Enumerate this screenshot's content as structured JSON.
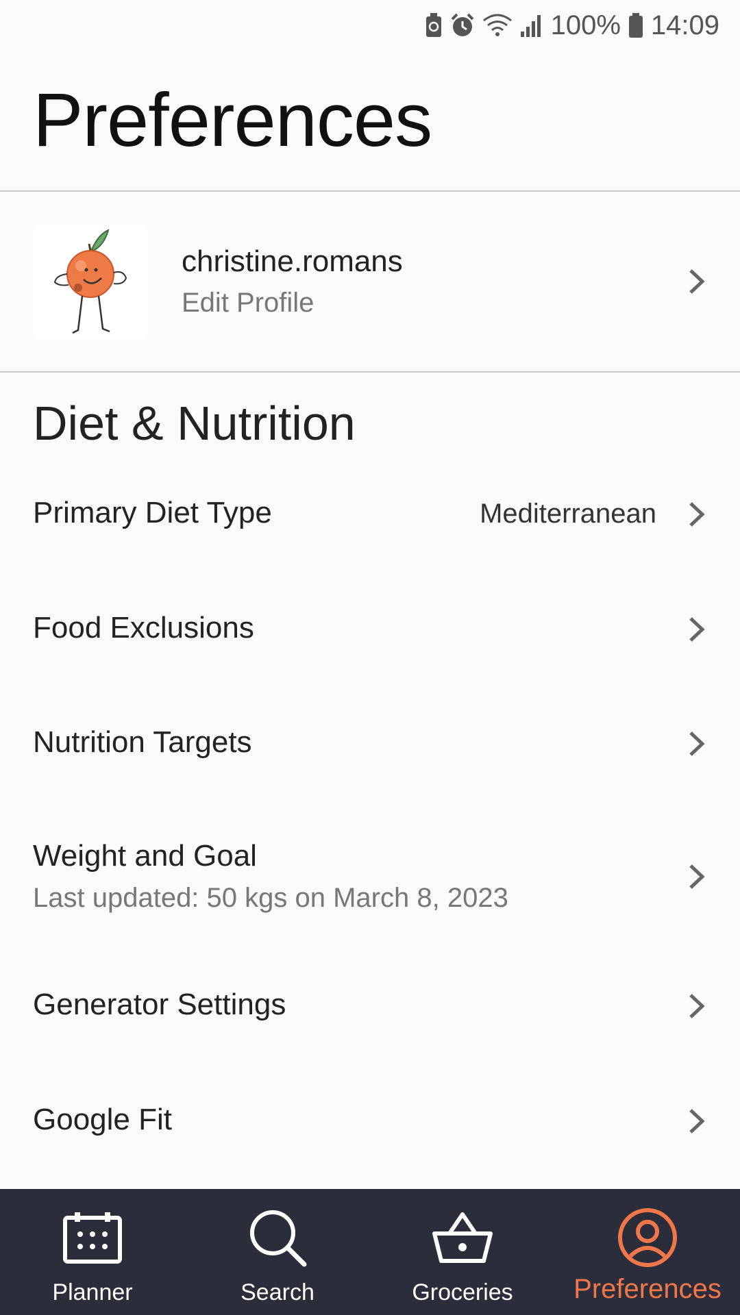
{
  "status_bar": {
    "battery_percent": "100%",
    "time": "14:09",
    "icons": [
      "battery-saver-icon",
      "alarm-icon",
      "wifi-icon",
      "signal-icon",
      "battery-icon"
    ]
  },
  "page": {
    "title": "Preferences"
  },
  "profile": {
    "username": "christine.romans",
    "subtitle": "Edit Profile",
    "avatar": "orange-character-avatar"
  },
  "section": {
    "title": "Diet & Nutrition"
  },
  "rows": [
    {
      "label": "Primary Diet Type",
      "value": "Mediterranean"
    },
    {
      "label": "Food Exclusions"
    },
    {
      "label": "Nutrition Targets"
    },
    {
      "label": "Weight and Goal",
      "sub": "Last updated:  50 kgs on March 8, 2023"
    },
    {
      "label": "Generator Settings"
    },
    {
      "label": "Google Fit"
    }
  ],
  "nav": {
    "items": [
      {
        "label": "Planner",
        "icon": "calendar-icon"
      },
      {
        "label": "Search",
        "icon": "search-icon"
      },
      {
        "label": "Groceries",
        "icon": "basket-icon"
      },
      {
        "label": "Preferences",
        "icon": "profile-icon"
      }
    ],
    "active_index": 3,
    "active_color": "#f0774a",
    "background": "#2c2d3b"
  }
}
